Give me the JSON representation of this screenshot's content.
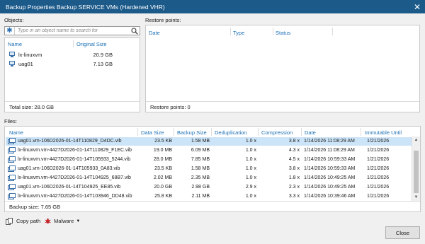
{
  "window": {
    "title": "Backup Properties Backup SERVICE VMs (Hardened VHR)",
    "close_glyph": "✕"
  },
  "objects": {
    "label": "Objects:",
    "search_placeholder": "Type in an object name to search for",
    "columns": {
      "name": "Name",
      "size": "Original Size"
    },
    "items": [
      {
        "name": "lx-linuxvm",
        "size": "20.9 GB"
      },
      {
        "name": "uag01",
        "size": "7.13 GB"
      }
    ],
    "footer": "Total size: 28.0 GB"
  },
  "restore": {
    "label": "Restore points:",
    "columns": {
      "date": "Date",
      "type": "Type",
      "status": "Status"
    },
    "footer": "Restore points: 0"
  },
  "files": {
    "label": "Files:",
    "columns": {
      "name": "Name",
      "data_size": "Data Size",
      "backup_size": "Backup Size",
      "dedup": "Deduplication",
      "compression": "Compression",
      "date": "Date",
      "immutable": "Immutable Until"
    },
    "rows": [
      {
        "name": "uag01.vm-106D2026-01-14T110829_D4DC.vib",
        "data_size": "23.5 KB",
        "backup_size": "1.58 MB",
        "dedup": "1.0 x",
        "compression": "3.8 x",
        "date": "1/14/2026 11:08:29 AM",
        "immutable": "1/21/2026",
        "selected": true
      },
      {
        "name": "lx-linuxvm.vm-4427D2026-01-14T110829_F1EC.vib",
        "data_size": "19.0 MB",
        "backup_size": "6.09 MB",
        "dedup": "1.0 x",
        "compression": "4.3 x",
        "date": "1/14/2026 11:08:29 AM",
        "immutable": "1/21/2026"
      },
      {
        "name": "lx-linuxvm.vm-4427D2026-01-14T105933_5244.vib",
        "data_size": "28.0 MB",
        "backup_size": "7.85 MB",
        "dedup": "1.0 x",
        "compression": "4.5 x",
        "date": "1/14/2026 10:59:33 AM",
        "immutable": "1/21/2026"
      },
      {
        "name": "uag01.vm-106D2026-01-14T105933_0A83.vib",
        "data_size": "23.5 KB",
        "backup_size": "1.58 MB",
        "dedup": "1.0 x",
        "compression": "3.8 x",
        "date": "1/14/2026 10:59:33 AM",
        "immutable": "1/21/2026"
      },
      {
        "name": "lx-linuxvm.vm-4427D2026-01-14T104925_68B7.vib",
        "data_size": "2.02 MB",
        "backup_size": "2.35 MB",
        "dedup": "1.0 x",
        "compression": "1.8 x",
        "date": "1/14/2026 10:49:25 AM",
        "immutable": "1/21/2026"
      },
      {
        "name": "uag01.vm-106D2026-01-14T104925_EE85.vib",
        "data_size": "20.0 GB",
        "backup_size": "2.98 GB",
        "dedup": "2.9 x",
        "compression": "2.3 x",
        "date": "1/14/2026 10:49:25 AM",
        "immutable": "1/21/2026"
      },
      {
        "name": "lx-linuxvm.vm-4427D2026-01-14T103946_DD48.vib",
        "data_size": "25.8 KB",
        "backup_size": "2.11 MB",
        "dedup": "1.0 x",
        "compression": "3.3 x",
        "date": "1/14/2026 10:39:46 AM",
        "immutable": "1/21/2026"
      }
    ],
    "footer": "Backup size: 7.65 GB"
  },
  "toolbar": {
    "copy_path": "Copy path",
    "malware": "Malware"
  },
  "buttons": {
    "close": "Close"
  },
  "colors": {
    "titlebar": "#1c5a8a",
    "header_text": "#1a6fb5",
    "selection": "#cce4f7",
    "malware_red": "#c0282d"
  },
  "icons": [
    "close-icon",
    "asterisk-icon",
    "search-icon",
    "vm-icon",
    "backup-file-icon",
    "copy-icon",
    "malware-icon",
    "chevron-down-icon",
    "scroll-up-icon",
    "scroll-down-icon"
  ]
}
